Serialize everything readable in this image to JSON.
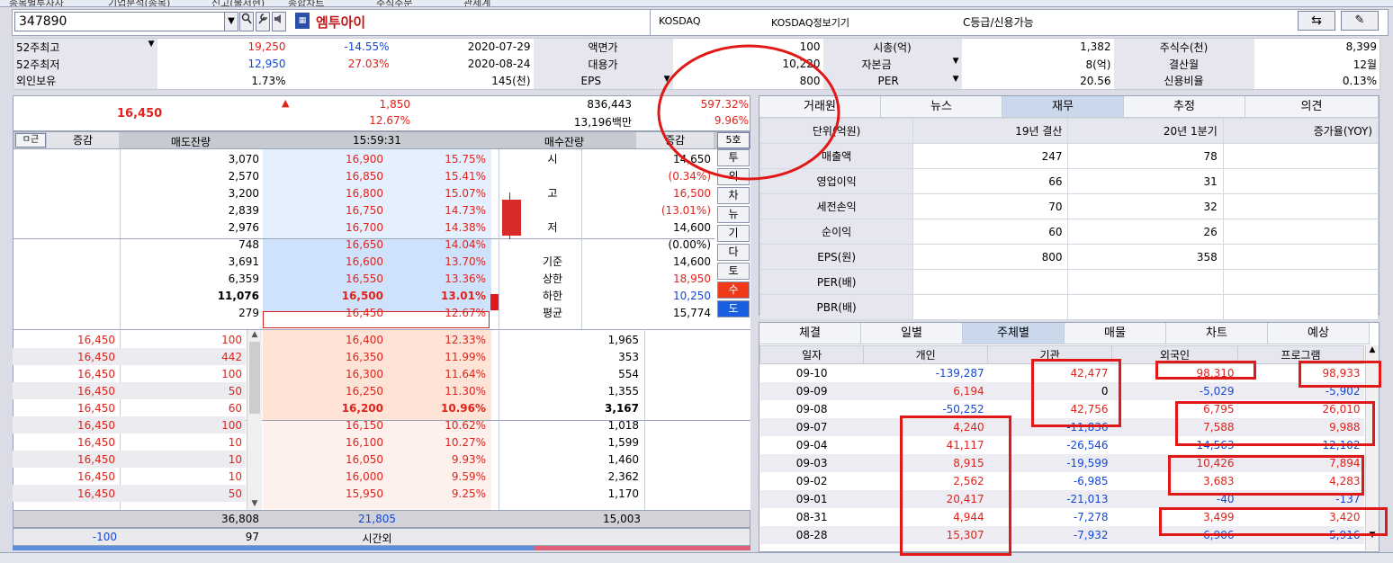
{
  "topbar": {
    "tabs": [
      "종목별투자자",
      "기업분석(종목)",
      "신고(불서현)",
      "종합차트",
      "주식주문",
      "관세계"
    ]
  },
  "header": {
    "code": "347890",
    "name": "엠투아이",
    "market": "KOSDAQ",
    "info": "KOSDAQ정보기기",
    "grade": "C등급/신용가능"
  },
  "info_rows": [
    {
      "label": "52주최고",
      "v1": "19,250",
      "v2": "-14.55%",
      "v3": "2020-07-29",
      "l2": "액면가",
      "v4": "100",
      "l3": "시총(억)",
      "v5": "1,382",
      "l4": "주식수(천)",
      "v6": "8,399"
    },
    {
      "label": "52주최저",
      "v1": "12,950",
      "v2": "27.03%",
      "v3": "2020-08-24",
      "l2": "대용가",
      "v4": "10,220",
      "l3": "자본금",
      "v5": "8(억)",
      "l4": "결산월",
      "v6": "12월"
    },
    {
      "label": "외인보유",
      "v1": "1.73%",
      "v2": "",
      "v3": "145(천)",
      "l2": "EPS",
      "v4": "800",
      "l3": "PER",
      "v5": "20.56",
      "l4": "신용비율",
      "v6": "0.13%"
    }
  ],
  "summary": {
    "price": "16,450",
    "arrow": "▲",
    "change": "1,850",
    "change_pct": "12.67%",
    "volume": "836,443",
    "amount": "13,196백만",
    "ratio1": "597.32%",
    "ratio2": "9.96%"
  },
  "ob_header": {
    "c0": "증감",
    "c1": "매도잔량",
    "c2": "15:59:31",
    "c3": "매수잔량",
    "c4": "증감",
    "btn": "5호"
  },
  "asks": [
    {
      "qty": "3,070",
      "price": "16,900",
      "pct": "15.75%"
    },
    {
      "qty": "2,570",
      "price": "16,850",
      "pct": "15.41%"
    },
    {
      "qty": "3,200",
      "price": "16,800",
      "pct": "15.07%"
    },
    {
      "qty": "2,839",
      "price": "16,750",
      "pct": "14.73%"
    },
    {
      "qty": "2,976",
      "price": "16,700",
      "pct": "14.38%"
    },
    {
      "qty": "748",
      "price": "16,650",
      "pct": "14.04%"
    },
    {
      "qty": "3,691",
      "price": "16,600",
      "pct": "13.70%"
    },
    {
      "qty": "6,359",
      "price": "16,550",
      "pct": "13.36%"
    },
    {
      "qty": "11,076",
      "price": "16,500",
      "pct": "13.01%"
    },
    {
      "qty": "279",
      "price": "16,450",
      "pct": "12.67%"
    }
  ],
  "stats": [
    {
      "label": "시",
      "value": "14,650"
    },
    {
      "label": "",
      "value": "(0.34%)"
    },
    {
      "label": "고",
      "value": "16,500"
    },
    {
      "label": "",
      "value": "(13.01%)"
    },
    {
      "label": "저",
      "value": "14,600"
    },
    {
      "label": "",
      "value": "(0.00%)"
    },
    {
      "label": "기준",
      "value": "14,600"
    },
    {
      "label": "상한",
      "value": "18,950"
    },
    {
      "label": "하한",
      "value": "10,250"
    },
    {
      "label": "평균",
      "value": "15,774"
    }
  ],
  "side_buttons": [
    "투",
    "외",
    "차",
    "뉴",
    "기",
    "다",
    "토",
    "수",
    "도"
  ],
  "ticks": [
    {
      "price": "16,450",
      "qty": "100"
    },
    {
      "price": "16,450",
      "qty": "442"
    },
    {
      "price": "16,450",
      "qty": "100"
    },
    {
      "price": "16,450",
      "qty": "50"
    },
    {
      "price": "16,450",
      "qty": "60"
    },
    {
      "price": "16,450",
      "qty": "100"
    },
    {
      "price": "16,450",
      "qty": "10"
    },
    {
      "price": "16,450",
      "qty": "10"
    },
    {
      "price": "16,450",
      "qty": "10"
    },
    {
      "price": "16,450",
      "qty": "50"
    }
  ],
  "bids": [
    {
      "price": "16,400",
      "pct": "12.33%",
      "qty": "1,965"
    },
    {
      "price": "16,350",
      "pct": "11.99%",
      "qty": "353"
    },
    {
      "price": "16,300",
      "pct": "11.64%",
      "qty": "554"
    },
    {
      "price": "16,250",
      "pct": "11.30%",
      "qty": "1,355"
    },
    {
      "price": "16,200",
      "pct": "10.96%",
      "qty": "3,167"
    },
    {
      "price": "16,150",
      "pct": "10.62%",
      "qty": "1,018"
    },
    {
      "price": "16,100",
      "pct": "10.27%",
      "qty": "1,599"
    },
    {
      "price": "16,050",
      "pct": "9.93%",
      "qty": "1,460"
    },
    {
      "price": "16,000",
      "pct": "9.59%",
      "qty": "2,362"
    },
    {
      "price": "15,950",
      "pct": "9.25%",
      "qty": "1,170"
    }
  ],
  "totals": {
    "ask_total": "36,808",
    "mid_total": "21,805",
    "bid_total": "15,003",
    "after_left": "-100",
    "after_qty": "97",
    "after_label": "시간외"
  },
  "fin_tabs": [
    "거래원",
    "뉴스",
    "재무",
    "추정",
    "의견"
  ],
  "fin_table": {
    "headers": [
      "단위(억원)",
      "19년 결산",
      "20년 1분기",
      "증가율(YOY)"
    ],
    "rows": [
      {
        "label": "매출액",
        "a": "247",
        "b": "78",
        "c": ""
      },
      {
        "label": "영업이익",
        "a": "66",
        "b": "31",
        "c": ""
      },
      {
        "label": "세전손익",
        "a": "70",
        "b": "32",
        "c": ""
      },
      {
        "label": "순이익",
        "a": "60",
        "b": "26",
        "c": ""
      },
      {
        "label": "EPS(원)",
        "a": "800",
        "b": "358",
        "c": ""
      },
      {
        "label": "PER(배)",
        "a": "",
        "b": "",
        "c": ""
      },
      {
        "label": "PBR(배)",
        "a": "",
        "b": "",
        "c": ""
      }
    ]
  },
  "inv_tabs": [
    "체결",
    "일별",
    "주체별",
    "매물",
    "차트",
    "예상"
  ],
  "inv_table": {
    "headers": [
      "일자",
      "개인",
      "기관",
      "외국인",
      "프로그램"
    ],
    "rows": [
      {
        "date": "09-10",
        "ind": "-139,287",
        "inst": "42,477",
        "fore": "98,310",
        "prog": "98,933"
      },
      {
        "date": "09-09",
        "ind": "6,194",
        "inst": "0",
        "fore": "-5,029",
        "prog": "-5,902"
      },
      {
        "date": "09-08",
        "ind": "-50,252",
        "inst": "42,756",
        "fore": "6,795",
        "prog": "26,010"
      },
      {
        "date": "09-07",
        "ind": "4,240",
        "inst": "-11,836",
        "fore": "7,588",
        "prog": "9,988"
      },
      {
        "date": "09-04",
        "ind": "41,117",
        "inst": "-26,546",
        "fore": "-14,563",
        "prog": "-12,102"
      },
      {
        "date": "09-03",
        "ind": "8,915",
        "inst": "-19,599",
        "fore": "10,426",
        "prog": "7,894"
      },
      {
        "date": "09-02",
        "ind": "2,562",
        "inst": "-6,985",
        "fore": "3,683",
        "prog": "4,283"
      },
      {
        "date": "09-01",
        "ind": "20,417",
        "inst": "-21,013",
        "fore": "-40",
        "prog": "-137"
      },
      {
        "date": "08-31",
        "ind": "4,944",
        "inst": "-7,278",
        "fore": "3,499",
        "prog": "3,420"
      },
      {
        "date": "08-28",
        "ind": "15,307",
        "inst": "-7,932",
        "fore": "-6,906",
        "prog": "-5,916"
      }
    ]
  }
}
